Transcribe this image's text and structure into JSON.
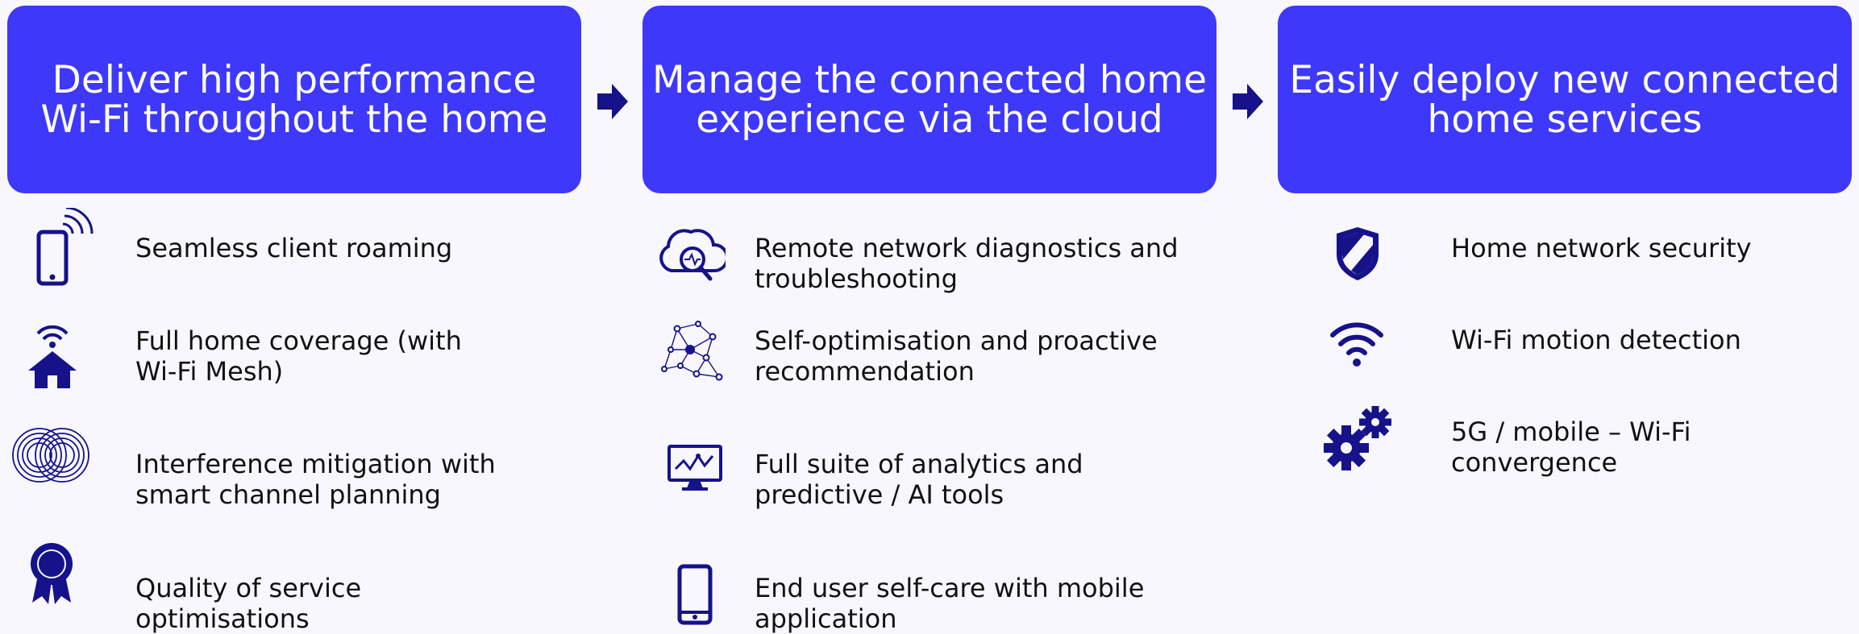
{
  "colors": {
    "header_bg": "#3e38fb",
    "icon": "#15128a",
    "text": "#111111",
    "background": "#f8f7fd"
  },
  "columns": [
    {
      "header": "Deliver high performance\nWi-Fi throughout the home",
      "items": [
        {
          "icon": "mobile-signal-icon",
          "text": "Seamless client roaming"
        },
        {
          "icon": "wifi-home-icon",
          "text": "Full home coverage (with\nWi-Fi Mesh)"
        },
        {
          "icon": "interference-rings-icon",
          "text": "Interference mitigation with\nsmart channel planning"
        },
        {
          "icon": "award-ribbon-icon",
          "text": "Quality of service\noptimisations"
        }
      ]
    },
    {
      "header": "Manage the connected home\nexperience via the cloud",
      "items": [
        {
          "icon": "cloud-diagnostics-icon",
          "text": "Remote network diagnostics and\ntroubleshooting"
        },
        {
          "icon": "network-nodes-icon",
          "text": "Self-optimisation and proactive\nrecommendation"
        },
        {
          "icon": "analytics-monitor-icon",
          "text": "Full suite of analytics and\npredictive / AI tools"
        },
        {
          "icon": "mobile-phone-icon",
          "text": "End user self-care with mobile\napplication"
        }
      ]
    },
    {
      "header": "Easily deploy new connected\nhome services",
      "items": [
        {
          "icon": "security-shield-icon",
          "text": "Home network security"
        },
        {
          "icon": "wifi-icon",
          "text": "Wi-Fi motion detection"
        },
        {
          "icon": "gears-icon",
          "text": "5G / mobile – Wi-Fi\nconvergence"
        }
      ]
    }
  ]
}
